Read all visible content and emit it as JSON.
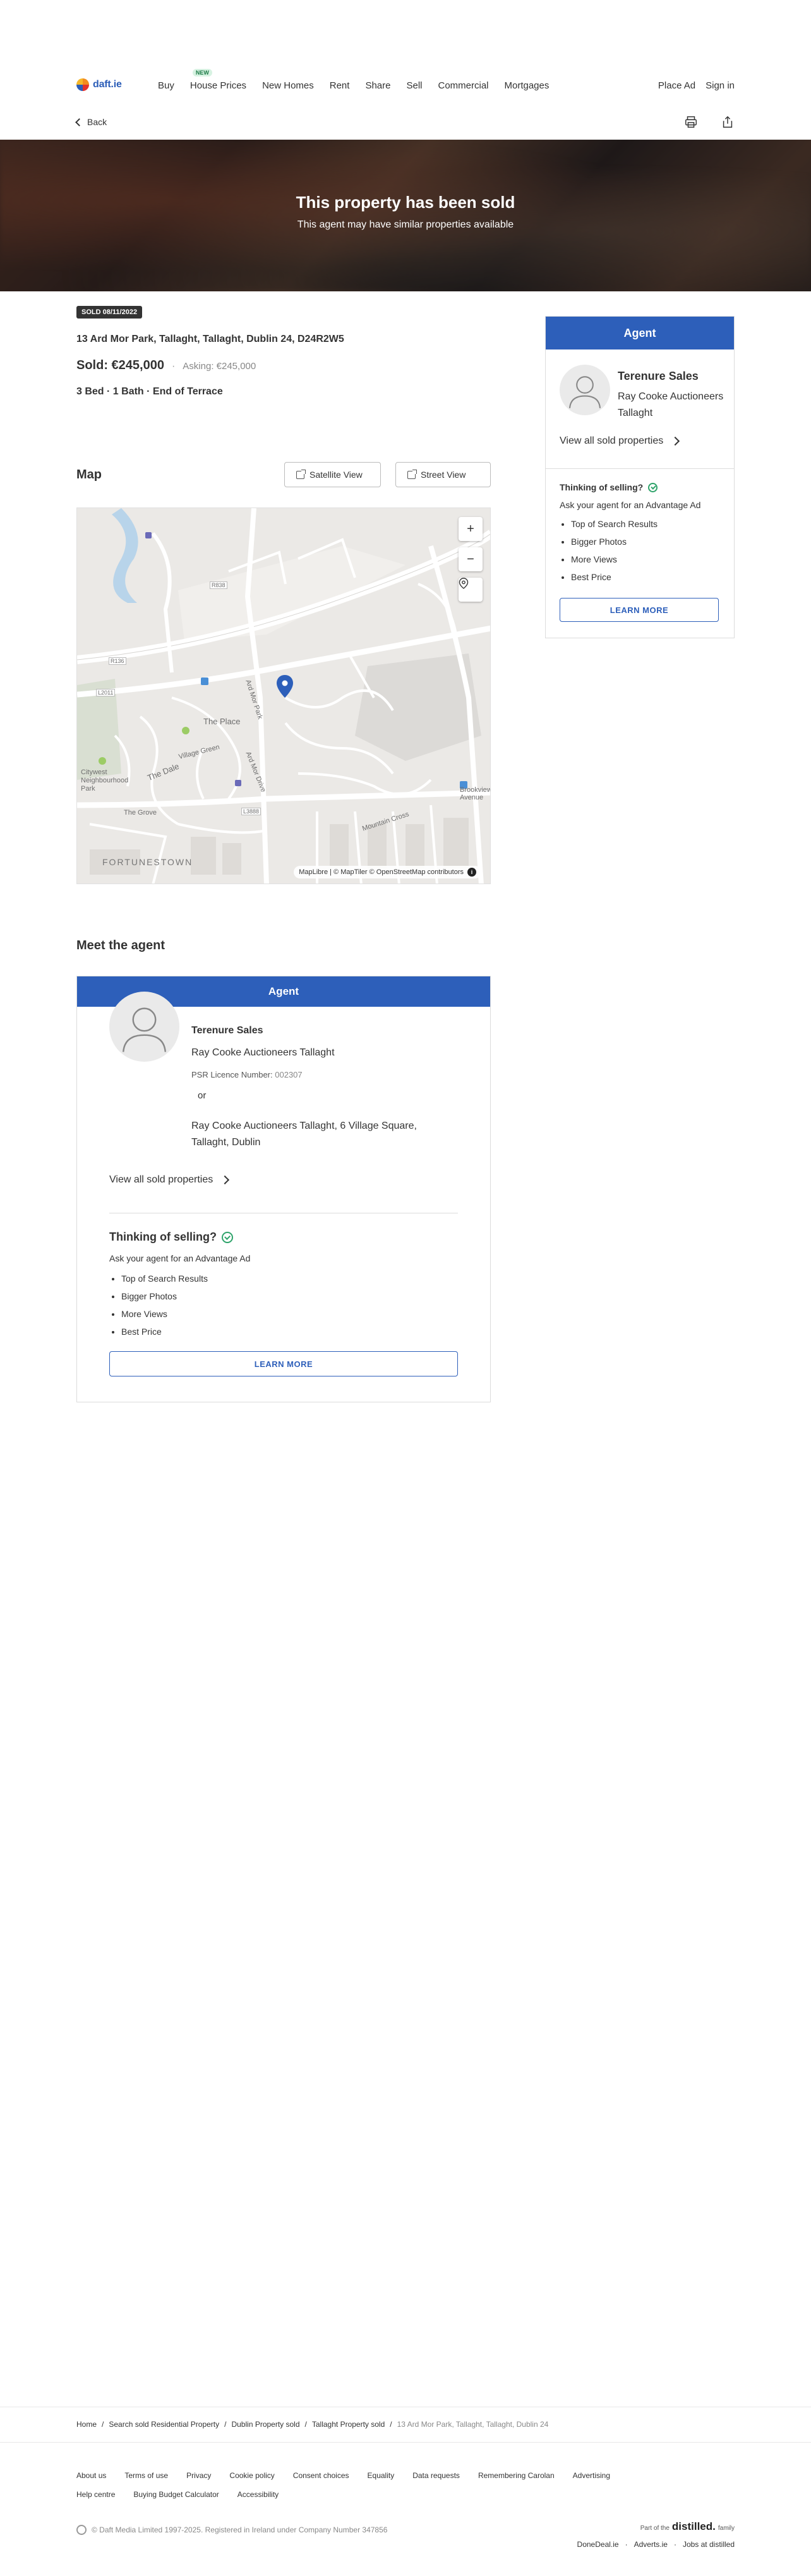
{
  "header": {
    "logo_text": "daft.ie",
    "nav": [
      {
        "label": "Buy"
      },
      {
        "label": "House Prices",
        "badge": "NEW"
      },
      {
        "label": "New Homes"
      },
      {
        "label": "Rent"
      },
      {
        "label": "Share"
      },
      {
        "label": "Sell"
      },
      {
        "label": "Commercial"
      },
      {
        "label": "Mortgages"
      }
    ],
    "place_ad": "Place Ad",
    "sign_in": "Sign in",
    "back": "Back",
    "print_icon": "printer-icon",
    "share_icon": "share-icon"
  },
  "hero": {
    "title": "This property has been sold",
    "subtitle": "This agent may have similar properties available"
  },
  "listing": {
    "sold_badge": "SOLD 08/11/2022",
    "address": "13 Ard Mor Park, Tallaght, Tallaght, Dublin 24, D24R2W5",
    "sold_price": "Sold: €245,000",
    "separator": "·",
    "asking": "Asking: €245,000",
    "features": "3 Bed · 1 Bath · End of Terrace"
  },
  "map": {
    "heading": "Map",
    "satellite_button": "Satellite View",
    "street_button": "Street View",
    "zoom_in": "+",
    "zoom_out": "−",
    "attribution": "MapLibre | © MapTiler © OpenStreetMap contributors",
    "info": "i",
    "labels": {
      "fortunestown": "FORTUNESTOWN",
      "village_green": "Village Green",
      "the_place": "The Place",
      "ard_mor_drive": "Ard Mor Drive",
      "the_dale": "The Dale",
      "the_grove": "The Grove",
      "ard_mor_park": "Ard Mor Park",
      "citywest_park": "Citywest Neighbourhood Park",
      "brookview": "Brookview Avenue",
      "mountain_cross": "Mountain Cross",
      "r838": "R838",
      "r136": "R136",
      "l3888": "L3888",
      "l2011": "L2011"
    }
  },
  "meet_agent": {
    "heading": "Meet the agent",
    "bar": "Agent",
    "name": "Terenure Sales",
    "company": "Ray Cooke Auctioneers Tallaght",
    "psr_label": "PSR Licence Number:",
    "psr_value": "002307",
    "or": "or",
    "address": "Ray Cooke Auctioneers Tallaght, 6 Village Square, Tallaght, Dublin",
    "sold_link": "View all sold properties",
    "selling_title": "Thinking of selling?",
    "selling_sub": "Ask your agent for an Advantage Ad",
    "benefits": [
      "Top of Search Results",
      "Bigger Photos",
      "More Views",
      "Best Price"
    ],
    "learn_more": "LEARN MORE"
  },
  "side_agent": {
    "bar": "Agent",
    "name": "Terenure Sales",
    "company": "Ray Cooke Auctioneers Tallaght",
    "sold_link": "View all sold properties",
    "selling_title": "Thinking of selling?",
    "selling_sub": "Ask your agent for an Advantage Ad",
    "benefits": [
      "Top of Search Results",
      "Bigger Photos",
      "More Views",
      "Best Price"
    ],
    "learn_more": "LEARN MORE"
  },
  "footer": {
    "breadcrumbs": [
      "Home",
      "Search sold Residential Property",
      "Dublin Property sold",
      "Tallaght Property sold",
      "13 Ard Mor Park, Tallaght, Tallaght, Dublin 24"
    ],
    "breadcrumb_sep": "/",
    "links": [
      "About us",
      "Terms of use",
      "Privacy",
      "Cookie policy",
      "Consent choices",
      "Equality",
      "Data requests",
      "Remembering Carolan",
      "Advertising",
      "Help centre",
      "Buying Budget Calculator",
      "Accessibility"
    ],
    "copyright": "© Daft Media Limited 1997-2025. Registered in Ireland under Company Number 347856",
    "family_prefix": "Part of the",
    "family_brand": "distilled.",
    "family_suffix": "family",
    "family_links": [
      "DoneDeal.ie",
      "Adverts.ie",
      "Jobs at distilled"
    ],
    "family_sep": "·"
  },
  "colors": {
    "brand_blue": "#2d5fba",
    "text": "#333333",
    "success_green": "#2ea36a"
  }
}
